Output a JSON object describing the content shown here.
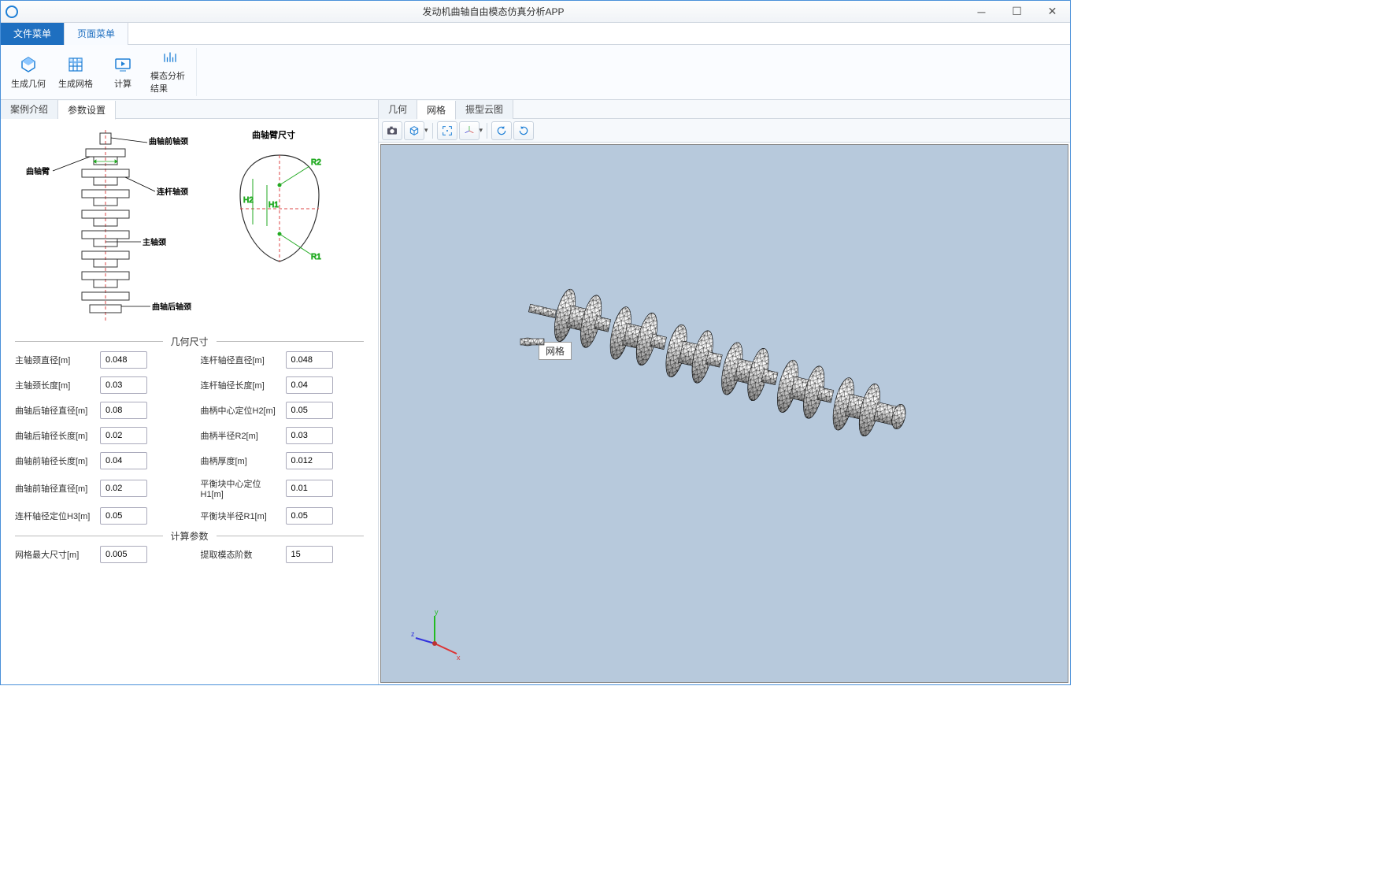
{
  "window": {
    "title": "发动机曲轴自由模态仿真分析APP"
  },
  "menus": {
    "file": "文件菜单",
    "page": "页面菜单"
  },
  "ribbon": {
    "gen_geom": "生成几何",
    "gen_mesh": "生成网格",
    "compute": "计算",
    "modal_result": "模态分析结果"
  },
  "left_tabs": {
    "case_intro": "案例介绍",
    "param_set": "参数设置"
  },
  "right_tabs": {
    "geometry": "几何",
    "mesh": "网格",
    "mode_cloud": "振型云图"
  },
  "diagram_labels": {
    "front_journal": "曲轴前轴颈",
    "crank_arm": "曲轴臂",
    "connrod_journal": "连杆轴颈",
    "main_journal": "主轴颈",
    "rear_journal": "曲轴后轴颈",
    "arm_dim": "曲轴臂尺寸",
    "r1": "R1",
    "r2": "R2",
    "h1": "H1",
    "h2": "H2"
  },
  "sections": {
    "geom": "几何尺寸",
    "calc": "计算参数"
  },
  "fields": {
    "main_journal_d": {
      "label": "主轴颈直径[m]",
      "value": "0.048"
    },
    "connrod_d": {
      "label": "连杆轴径直径[m]",
      "value": "0.048"
    },
    "main_journal_l": {
      "label": "主轴颈长度[m]",
      "value": "0.03"
    },
    "connrod_l": {
      "label": "连杆轴径长度[m]",
      "value": "0.04"
    },
    "rear_d": {
      "label": "曲轴后轴径直径[m]",
      "value": "0.08"
    },
    "crank_h2": {
      "label": "曲柄中心定位H2[m]",
      "value": "0.05"
    },
    "rear_l": {
      "label": "曲轴后轴径长度[m]",
      "value": "0.02"
    },
    "crank_r2": {
      "label": "曲柄半径R2[m]",
      "value": "0.03"
    },
    "front_l": {
      "label": "曲轴前轴径长度[m]",
      "value": "0.04"
    },
    "crank_thick": {
      "label": "曲柄厚度[m]",
      "value": "0.012"
    },
    "front_d": {
      "label": "曲轴前轴径直径[m]",
      "value": "0.02"
    },
    "balance_h1": {
      "label": "平衡块中心定位H1[m]",
      "value": "0.01"
    },
    "connrod_h3": {
      "label": "连杆轴径定位H3[m]",
      "value": "0.05"
    },
    "balance_r1": {
      "label": "平衡块半径R1[m]",
      "value": "0.05"
    },
    "mesh_max": {
      "label": "网格最大尺寸[m]",
      "value": "0.005"
    },
    "modal_order": {
      "label": "提取模态阶数",
      "value": "15"
    }
  },
  "viewport": {
    "mesh_label": "网格"
  }
}
